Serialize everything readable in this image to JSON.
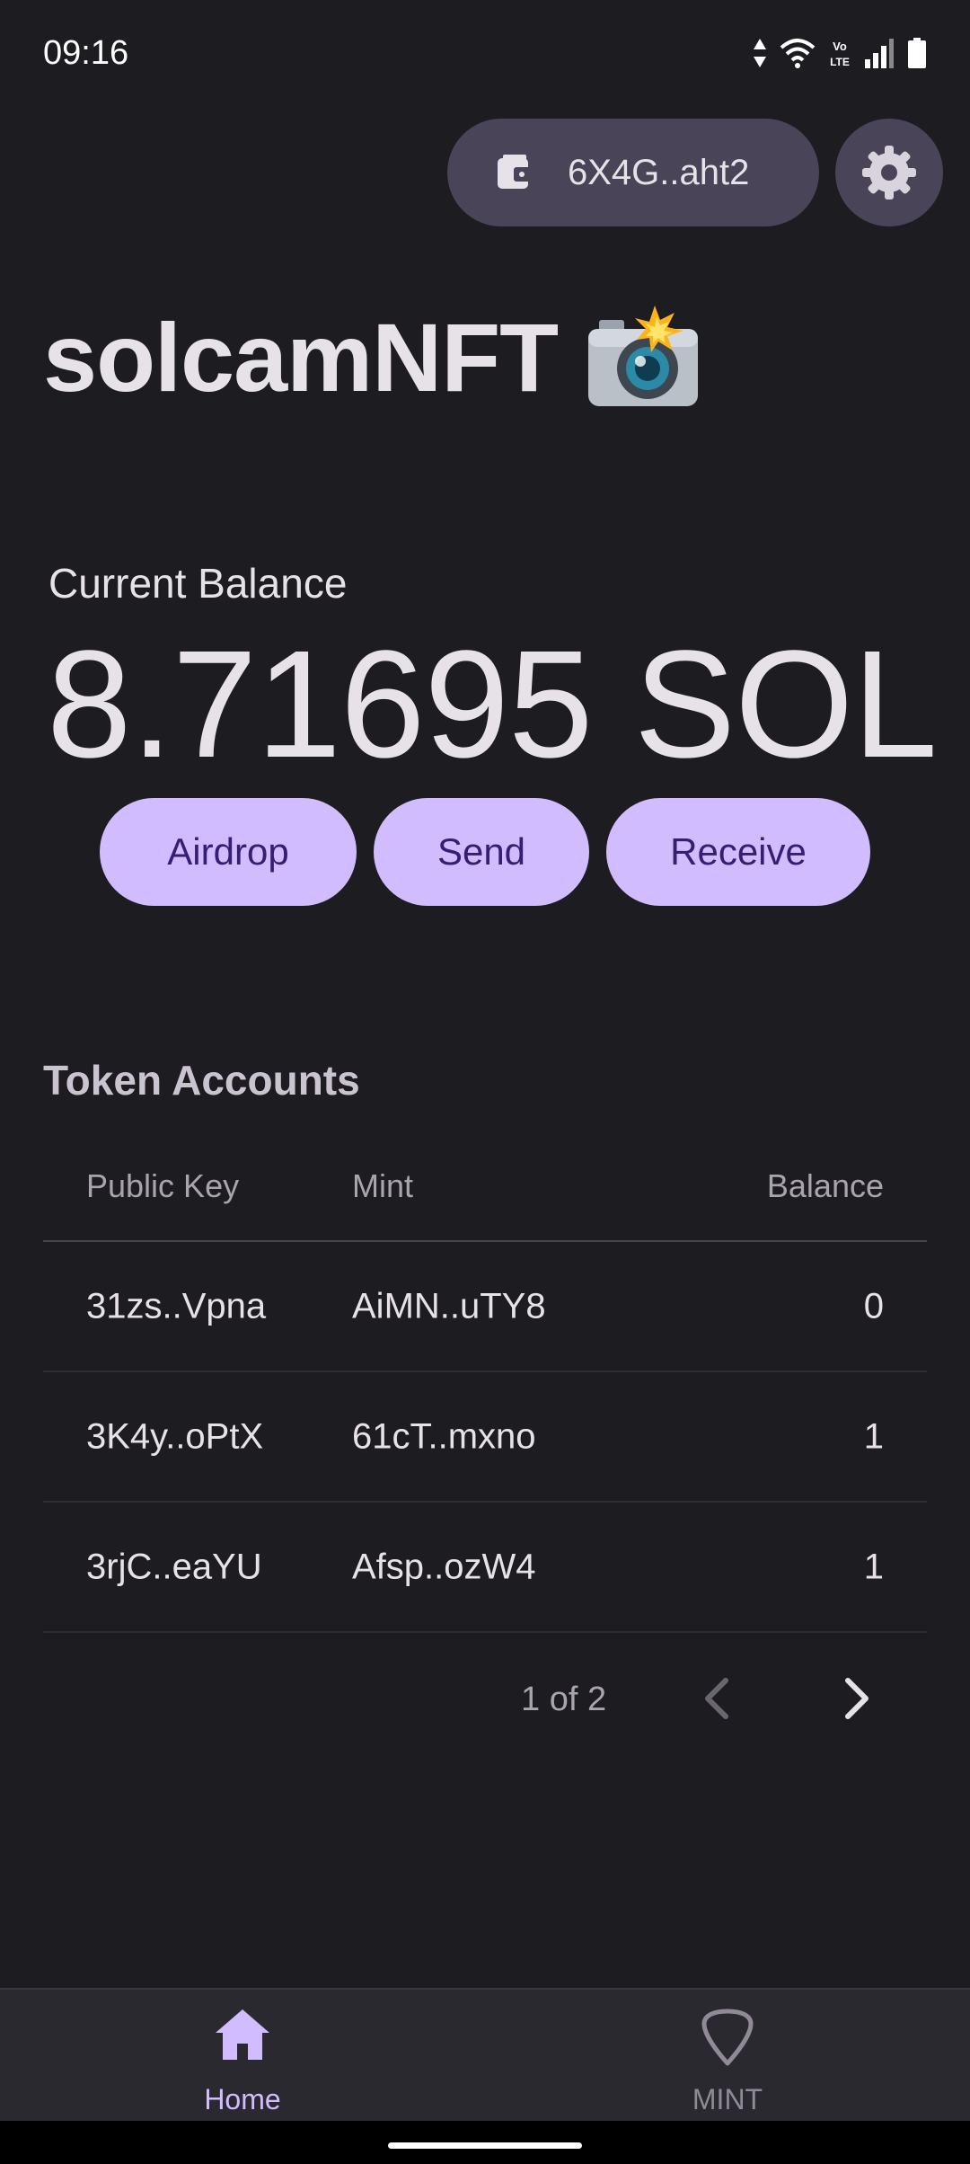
{
  "status_bar": {
    "time": "09:16",
    "icons": [
      "data-arrows-icon",
      "wifi-icon",
      "volte-icon",
      "signal-icon",
      "battery-icon"
    ]
  },
  "header": {
    "wallet_address": "6X4G..aht2",
    "wallet_icon": "wallet-icon",
    "settings_icon": "gear-icon"
  },
  "app": {
    "title": "solcamNFT",
    "title_icon": "camera-flash-icon"
  },
  "balance": {
    "label": "Current Balance",
    "value": "8.71695 SOL"
  },
  "actions": {
    "airdrop": "Airdrop",
    "send": "Send",
    "receive": "Receive"
  },
  "token_accounts": {
    "title": "Token Accounts",
    "columns": [
      "Public Key",
      "Mint",
      "Balance"
    ],
    "rows": [
      {
        "public_key": "31zs..Vpna",
        "mint": "AiMN..uTY8",
        "balance": "0"
      },
      {
        "public_key": "3K4y..oPtX",
        "mint": "61cT..mxno",
        "balance": "1"
      },
      {
        "public_key": "3rjC..eaYU",
        "mint": "Afsp..ozW4",
        "balance": "1"
      }
    ],
    "pagination": {
      "text": "1 of 2",
      "prev_icon": "chevron-left-icon",
      "next_icon": "chevron-right-icon"
    }
  },
  "bottom_nav": {
    "items": [
      {
        "label": "Home",
        "icon": "home-icon",
        "active": true
      },
      {
        "label": "MINT",
        "icon": "pick-icon",
        "active": false
      }
    ]
  },
  "colors": {
    "background": "#1d1c21",
    "accent": "#d0bcfe",
    "on_accent": "#381e72",
    "pill": "#494458",
    "nav_bar": "#2b2930"
  }
}
